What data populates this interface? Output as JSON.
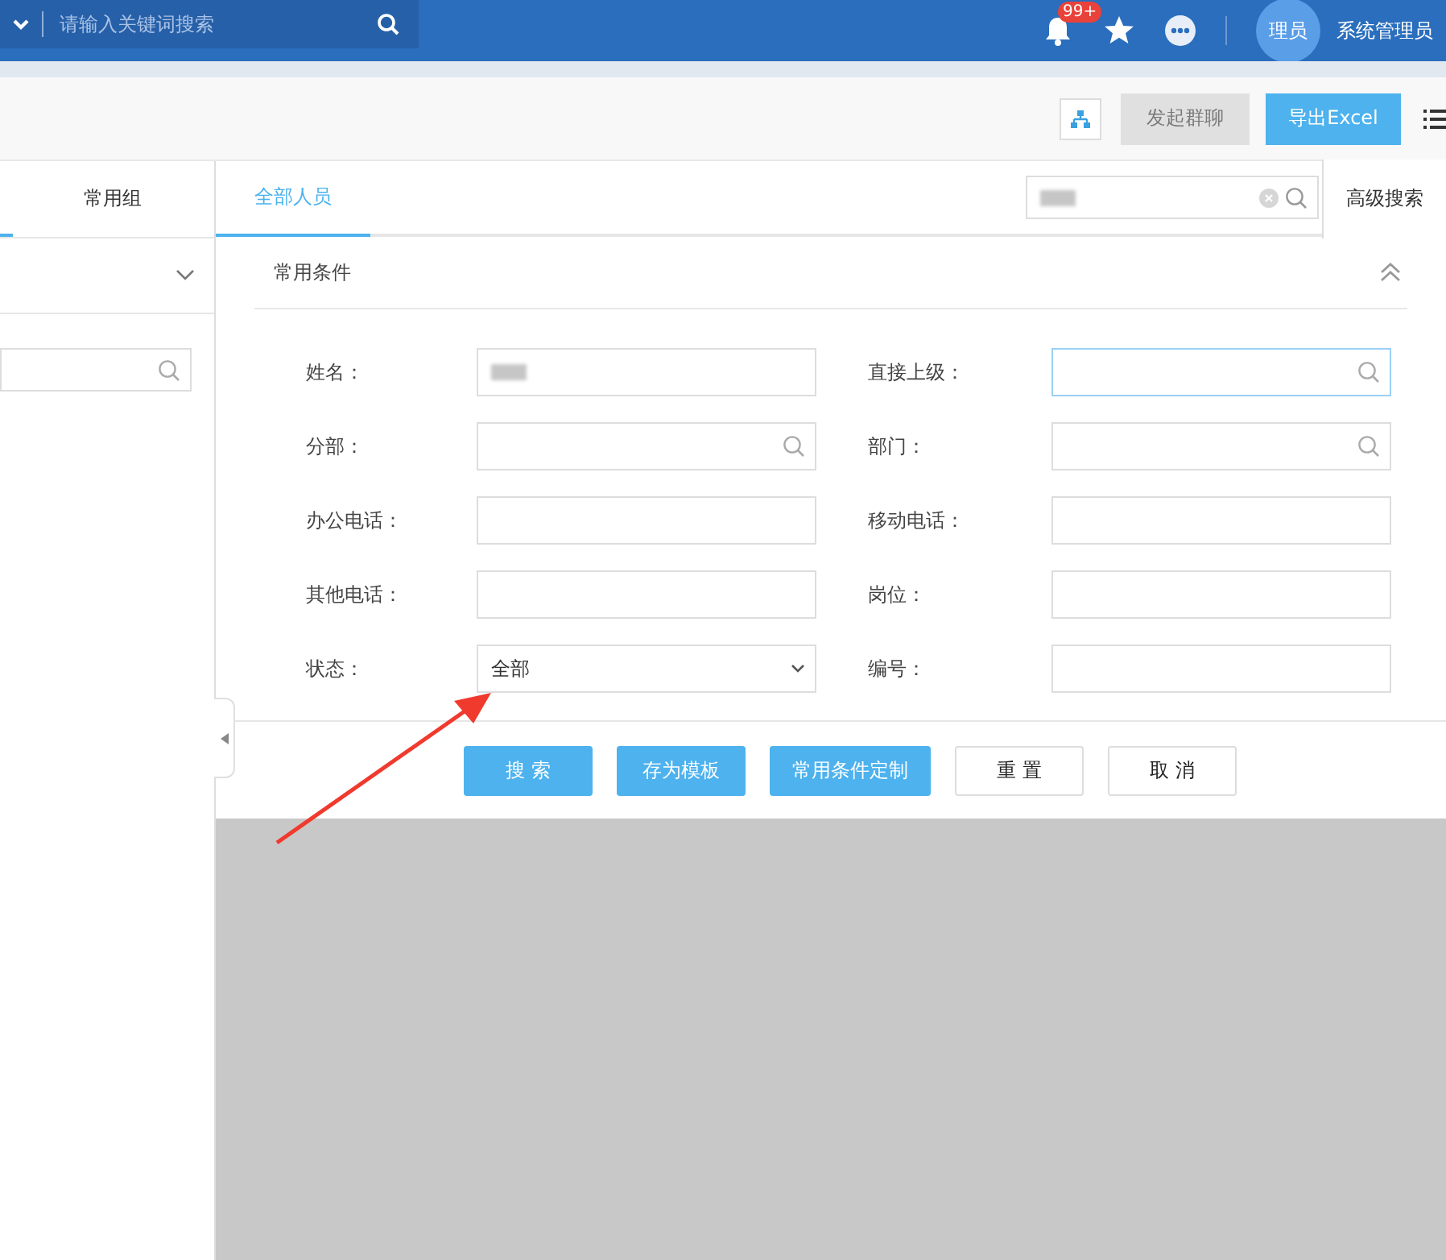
{
  "topbar": {
    "search": {
      "placeholder": "请输入关键词搜索"
    },
    "notification_badge": "99+",
    "avatar": "理员",
    "user": "系统管理员"
  },
  "toolbar": {
    "buttons": [
      {
        "label": "发起群聊",
        "kind": "disabled"
      },
      {
        "label": "导出Excel",
        "kind": "primary"
      }
    ]
  },
  "sidebar": {
    "tabs": [
      {
        "label": "常用组",
        "selected": false
      }
    ]
  },
  "tabs": [
    {
      "label": "全部人员",
      "selected": true
    }
  ],
  "advanced_search": {
    "label": "高级搜索",
    "selected": true
  },
  "form": {
    "title": "常用条件",
    "fields": [
      {
        "label": "姓名：",
        "kind": "text",
        "focused": false,
        "blurred": true
      },
      {
        "label": "直接上级：",
        "kind": "search",
        "focused": true
      },
      {
        "label": "分部：",
        "kind": "search",
        "focused": false
      },
      {
        "label": "部门：",
        "kind": "search",
        "focused": false
      },
      {
        "label": "办公电话：",
        "kind": "text",
        "focused": false
      },
      {
        "label": "移动电话：",
        "kind": "text",
        "focused": false
      },
      {
        "label": "其他电话：",
        "kind": "text",
        "focused": false
      },
      {
        "label": "岗位：",
        "kind": "text",
        "focused": false
      },
      {
        "label": "状态：",
        "kind": "select",
        "value": "全部",
        "focused": false
      },
      {
        "label": "编号：",
        "kind": "text",
        "focused": false
      }
    ]
  },
  "actions": [
    {
      "label": "搜 索",
      "kind": "primary"
    },
    {
      "label": "存为模板",
      "kind": "primary"
    },
    {
      "label": "常用条件定制",
      "kind": "primary"
    },
    {
      "label": "重 置",
      "kind": "plain"
    },
    {
      "label": "取 消",
      "kind": "plain"
    }
  ]
}
